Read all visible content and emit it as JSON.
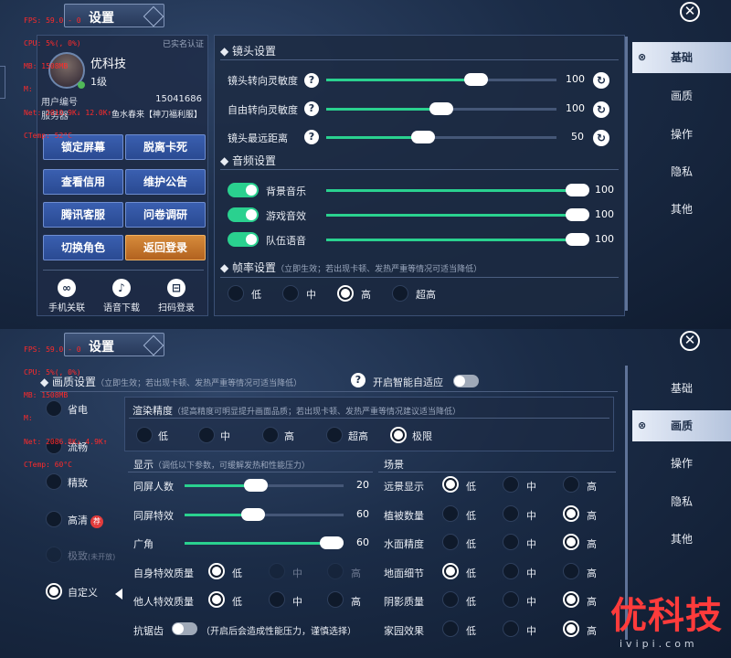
{
  "debug": {
    "top": [
      "FPS: 59.0 - 0",
      "CPU: 5%(, 0%)",
      "MB: 1508MB",
      "M:",
      "Net: 2010.9K↓ 12.0K↑",
      "CTemp: 52°C"
    ],
    "bottom": [
      "FPS: 59.0 - 0",
      "CPU: 5%(, 0%)",
      "MB: 1508MB",
      "M:",
      "Net: 2086.8K↓ 4.9K↑",
      "CTemp: 60°C"
    ]
  },
  "window": {
    "title": "设置",
    "close_glyph": "✕"
  },
  "profile": {
    "verified": "已实名认证",
    "name": "优科技",
    "level": "1级",
    "account_label": "用户编号",
    "account_value": "15041686",
    "server_label": "服务器",
    "server_value": "鱼水春来【神刀福利服】",
    "buttons": [
      "锁定屏幕",
      "脱离卡死",
      "查看信用",
      "维护公告",
      "腾讯客服",
      "问卷调研",
      "切换角色",
      "返回登录"
    ],
    "icons": [
      {
        "label": "手机关联",
        "glyph": "∞",
        "icon": "link-icon"
      },
      {
        "label": "语音下载",
        "glyph": "♪",
        "icon": "music-icon"
      },
      {
        "label": "扫码登录",
        "glyph": "⊟",
        "icon": "scan-icon"
      }
    ]
  },
  "camera": {
    "title": "镜头设置",
    "rows": [
      {
        "label": "镜头转向灵敏度",
        "value": 100,
        "percent": 0.65
      },
      {
        "label": "自由转向灵敏度",
        "value": 100,
        "percent": 0.5
      },
      {
        "label": "镜头最远距离",
        "value": 50,
        "percent": 0.42
      }
    ],
    "help": "?",
    "reset": "↻"
  },
  "audio": {
    "title": "音频设置",
    "rows": [
      {
        "label": "背景音乐",
        "value": 100
      },
      {
        "label": "游戏音效",
        "value": 100
      },
      {
        "label": "队伍语音",
        "value": 100
      }
    ]
  },
  "framerate": {
    "title": "帧率设置",
    "hint": "（立即生效；若出现卡顿、发热严重等情况可适当降低）",
    "options": [
      "低",
      "中",
      "高",
      "超高"
    ],
    "selected": "高"
  },
  "nav": {
    "items": [
      "基础",
      "画质",
      "操作",
      "隐私",
      "其他"
    ],
    "active_top": "基础",
    "active_bottom": "画质"
  },
  "quality": {
    "title": "画质设置",
    "hint": "（立即生效；若出现卡顿、发热严重等情况可适当降低）",
    "help": "?",
    "adaptive_label": "开启智能自适应",
    "presets": [
      "省电",
      "流畅",
      "精致",
      "高清",
      "极致",
      "自定义"
    ],
    "preset_badge": "荐",
    "preset_disabled_note": "(未开放)",
    "preset_selected": "自定义",
    "render": {
      "title": "渲染精度",
      "hint": "（提高精度可明显提升画面品质；若出现卡顿、发热严重等情况建议适当降低）",
      "options": [
        "低",
        "中",
        "高",
        "超高",
        "极限"
      ],
      "selected": "极限"
    },
    "display": {
      "title": "显示",
      "hint": "（调低以下参数，可缓解发热和性能压力）",
      "sliders": [
        {
          "label": "同屏人数",
          "value": 20,
          "percent": 0.45
        },
        {
          "label": "同屏特效",
          "value": 60,
          "percent": 0.43
        },
        {
          "label": "广角",
          "value": 60,
          "percent": 0.93
        }
      ],
      "radios": [
        {
          "label": "自身特效质量",
          "options": [
            "低",
            "中",
            "高"
          ],
          "selected": "低"
        },
        {
          "label": "他人特效质量",
          "options": [
            "低",
            "中",
            "高"
          ],
          "selected": "低"
        }
      ],
      "antialias_label": "抗锯齿",
      "antialias_hint": "（开启后会造成性能压力，谨慎选择）"
    },
    "scene": {
      "title": "场景",
      "rows": [
        {
          "label": "远景显示",
          "options": [
            "低",
            "中",
            "高"
          ],
          "selected": "低"
        },
        {
          "label": "植被数量",
          "options": [
            "低",
            "中",
            "高"
          ],
          "selected": "高"
        },
        {
          "label": "水面精度",
          "options": [
            "低",
            "中",
            "高"
          ],
          "selected": "高"
        },
        {
          "label": "地面细节",
          "options": [
            "低",
            "中",
            "高"
          ],
          "selected": "低"
        },
        {
          "label": "阴影质量",
          "options": [
            "低",
            "中",
            "高"
          ],
          "selected": "高"
        },
        {
          "label": "家园效果",
          "options": [
            "低",
            "中",
            "高"
          ],
          "selected": "高"
        }
      ]
    }
  },
  "watermark": {
    "brand": "优科技",
    "url": "ivipi.com"
  },
  "colors": {
    "accent": "#2ad18f",
    "orange": "#d68b3b",
    "badge": "#e23c3c"
  }
}
